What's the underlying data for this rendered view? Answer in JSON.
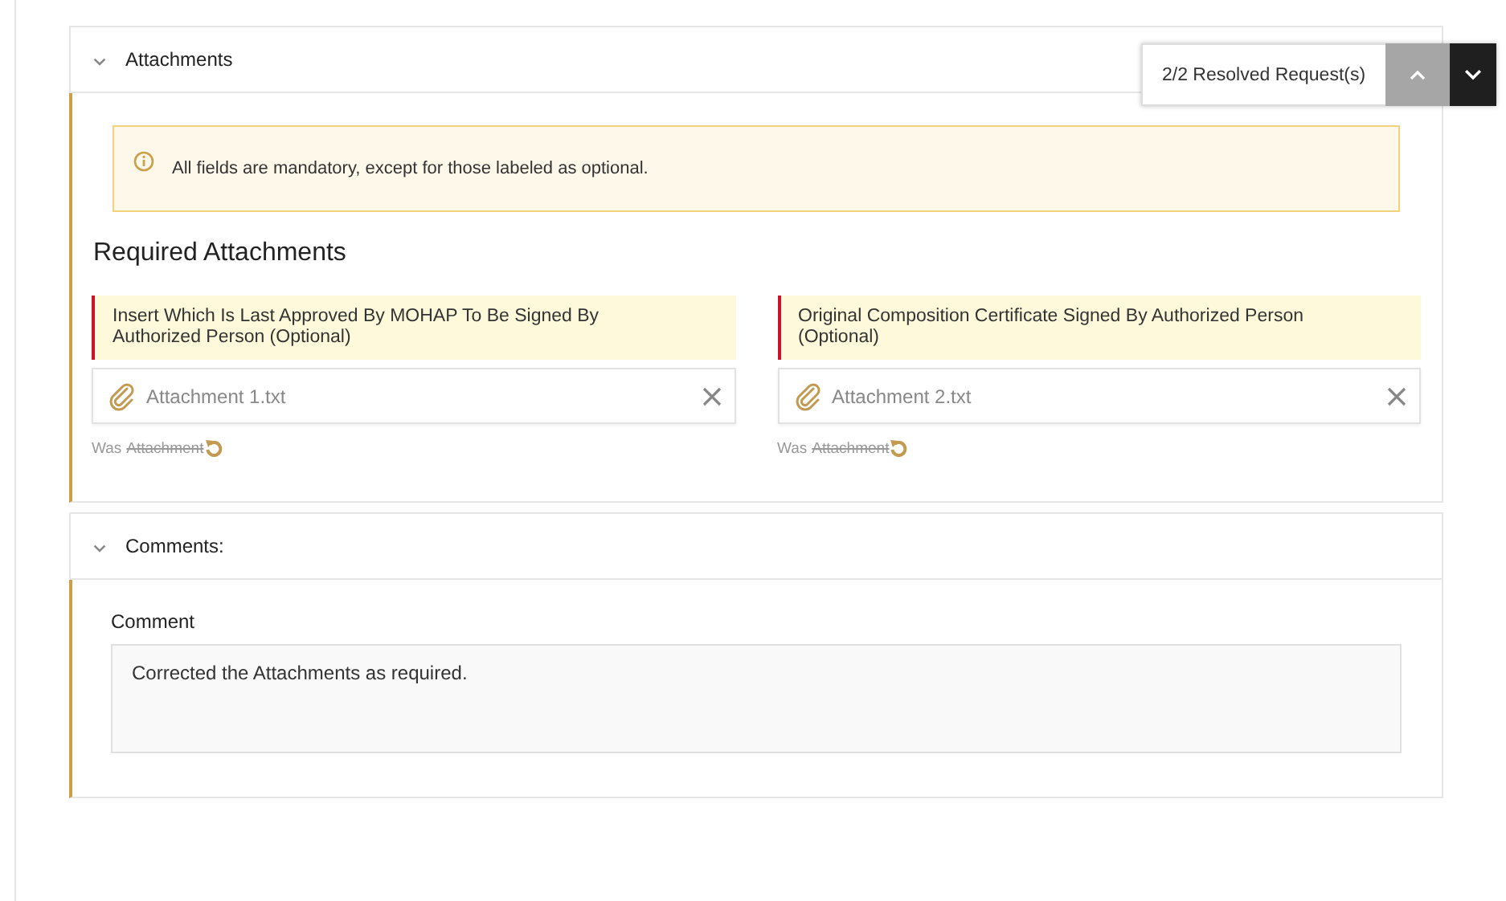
{
  "resolved_widget": {
    "label": "2/2 Resolved Request(s)"
  },
  "sections": [
    {
      "kind": "attachments",
      "title": "Attachments",
      "expanded": true,
      "notice": "All fields are mandatory, except for those labeled as optional.",
      "heading": "Required Attachments",
      "items": [
        {
          "label": "Insert Which Is Last Approved By MOHAP To Be Signed By Authorized Person (Optional)",
          "file": "Attachment 1.txt",
          "was_label": "Was",
          "previous_value": "Attachment"
        },
        {
          "label": "Original Composition Certificate Signed By Authorized Person (Optional)",
          "file": "Attachment 2.txt",
          "was_label": "Was",
          "previous_value": "Attachment"
        }
      ]
    },
    {
      "kind": "comments",
      "title": "Comments:",
      "expanded": true,
      "field_label": "Comment",
      "value": "Corrected the Attachments as required."
    }
  ]
}
